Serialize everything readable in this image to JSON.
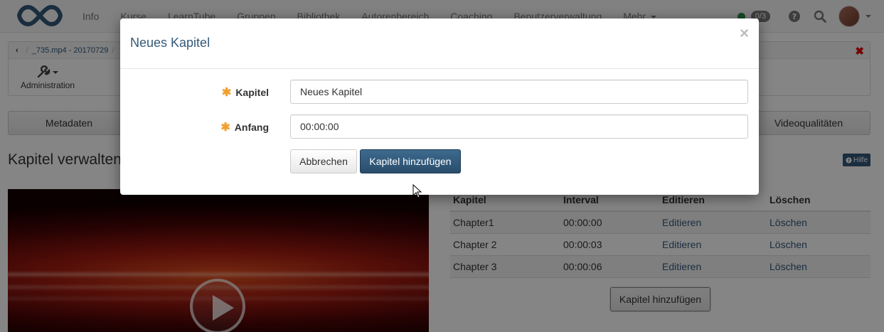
{
  "navbar": {
    "items": [
      "Info",
      "Kurse",
      "LearnTube",
      "Gruppen",
      "Bibliothek",
      "Autorenbereich",
      "Coaching",
      "Benutzerverwaltung",
      "Mehr"
    ],
    "badge": "0/3",
    "icons": [
      "help-icon",
      "search-icon"
    ]
  },
  "breadcrumb": {
    "items": [
      "_735.mp4 - 20170729"
    ]
  },
  "toolbar": {
    "admin_label": "Administration"
  },
  "tabs": {
    "left": "Metadaten",
    "right": "Videoqualitäten"
  },
  "page": {
    "title": "Kapitel verwalten",
    "help": "Hilfe"
  },
  "chapters": {
    "headers": [
      "Kapitel",
      "Interval",
      "Editieren",
      "Löschen"
    ],
    "rows": [
      {
        "name": "Chapter1",
        "interval": "00:00:00",
        "edit": "Editieren",
        "delete": "Löschen"
      },
      {
        "name": "Chapter 2",
        "interval": "00:00:03",
        "edit": "Editieren",
        "delete": "Löschen"
      },
      {
        "name": "Chapter 3",
        "interval": "00:00:06",
        "edit": "Editieren",
        "delete": "Löschen"
      }
    ],
    "add_button": "Kapitel hinzufügen"
  },
  "modal": {
    "title": "Neues Kapitel",
    "close": "×",
    "fields": {
      "kapitel_label": "Kapitel",
      "kapitel_value": "Neues Kapitel",
      "anfang_label": "Anfang",
      "anfang_value": "00:00:00"
    },
    "cancel": "Abbrechen",
    "submit": "Kapitel hinzufügen"
  },
  "colors": {
    "primary": "#34597a",
    "required": "#f0a030",
    "status_online": "#2e8b4a",
    "close_red": "#dd0000"
  }
}
